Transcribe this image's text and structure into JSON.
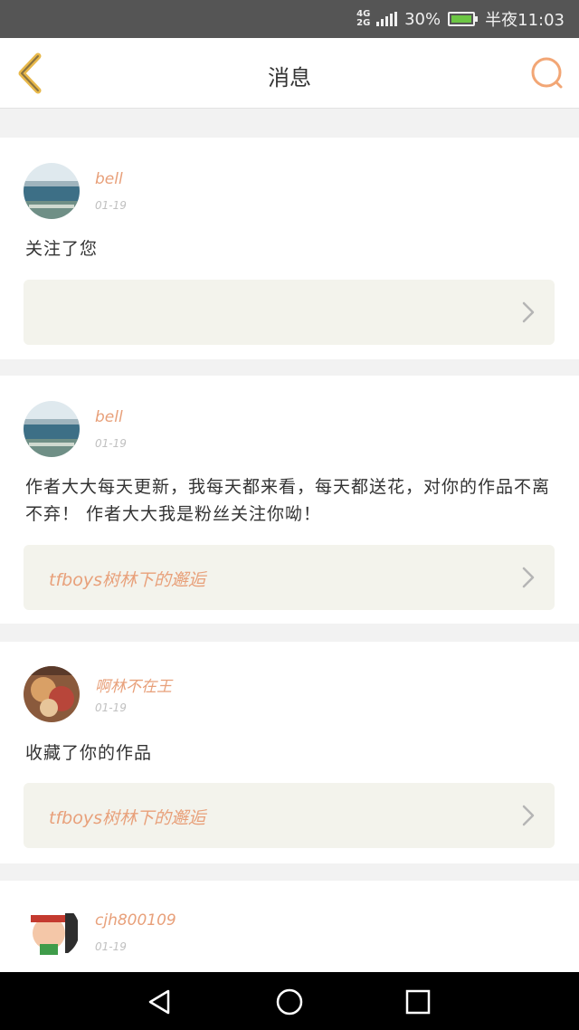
{
  "status_bar": {
    "network_top": "4G",
    "network_bottom": "2G",
    "battery_percent": "30%",
    "time": "半夜11:03"
  },
  "header": {
    "title": "消息",
    "back_icon": "chevron-left-icon",
    "search_icon": "search-icon"
  },
  "colors": {
    "accent": "#e8a07a",
    "back_arrow": "#e8b84a",
    "search": "#f2a675",
    "link_bg": "#f3f3ec"
  },
  "notifications": [
    {
      "user": "bell",
      "time": "01-19",
      "message": "关注了您",
      "work": ""
    },
    {
      "user": "bell",
      "time": "01-19",
      "message": "作者大大每天更新，我每天都来看，每天都送花，对你的作品不离不弃！ 作者大大我是粉丝关注你呦！",
      "work": "tfboys树林下的邂逅"
    },
    {
      "user": "啊林不在王",
      "time": "01-19",
      "message": "收藏了你的作品",
      "work": "tfboys树林下的邂逅"
    },
    {
      "user": "cjh800109",
      "time": "01-19"
    }
  ],
  "system_nav": {
    "back": "triangle-back-icon",
    "home": "circle-home-icon",
    "recents": "square-recents-icon"
  }
}
